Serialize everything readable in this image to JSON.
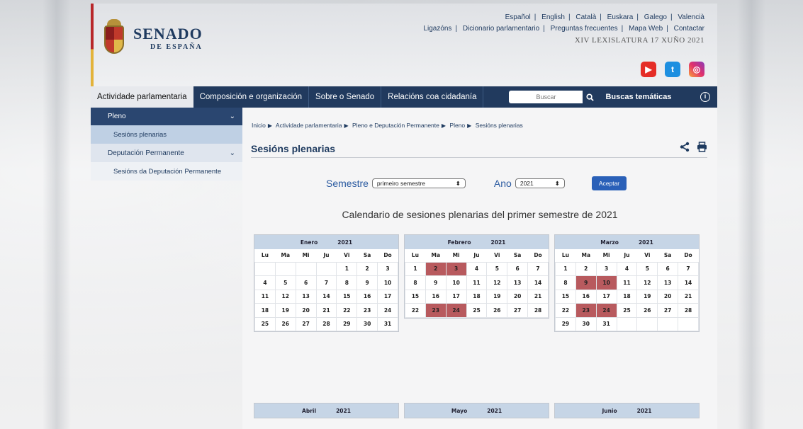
{
  "header": {
    "logo_title": "SENADO",
    "logo_subtitle": "DE ESPAÑA",
    "languages": [
      "Español",
      "English",
      "Català",
      "Euskara",
      "Galego",
      "Valencià"
    ],
    "links": [
      "Ligazóns",
      "Dicionario parlamentario",
      "Preguntas frecuentes",
      "Mapa Web",
      "Contactar"
    ],
    "legislature": "XIV LEXISLATURA 17 XUÑO 2021",
    "social_icons": [
      "youtube-icon",
      "twitter-icon",
      "instagram-icon"
    ]
  },
  "nav": {
    "items": [
      "Actividade parlamentaria",
      "Composición e organización",
      "Sobre o Senado",
      "Relacións coa cidadanía"
    ],
    "search_placeholder": "Buscar",
    "tematicas": "Buscas temáticas",
    "info_glyph": "i"
  },
  "sidebar": {
    "pleno": "Pleno",
    "sesions_plenarias": "Sesións plenarias",
    "deputacion": "Deputación Permanente",
    "sesions_deputacion": "Sesións da Deputación Permanente"
  },
  "main": {
    "breadcrumb": [
      "Inicio",
      "Actividade parlamentaria",
      "Pleno e Deputación Permanente",
      "Pleno",
      "Sesións plenarias"
    ],
    "title": "Sesións plenarias",
    "semestre_label": "Semestre",
    "semestre_value": "primeiro semestre",
    "ano_label": "Ano",
    "ano_value": "2021",
    "accept": "Aceptar",
    "calendar_heading": "Calendario de sesiones plenarias del primer semestre de 2021"
  },
  "weekdays": [
    "Lu",
    "Ma",
    "Mi",
    "Ju",
    "Vi",
    "Sa",
    "Do"
  ],
  "colors": {
    "nav": "#213a5e",
    "highlight": "#b85a5e",
    "cal_header": "#c6d5e6"
  },
  "calendars": [
    {
      "month": "Enero",
      "year": "2021",
      "offset": 4,
      "days": 31,
      "highlight": []
    },
    {
      "month": "Febrero",
      "year": "2021",
      "offset": 0,
      "days": 28,
      "highlight": [
        2,
        3,
        23,
        24
      ]
    },
    {
      "month": "Marzo",
      "year": "2021",
      "offset": 0,
      "days": 31,
      "highlight": [
        9,
        10,
        23,
        24
      ]
    },
    {
      "month": "Abril",
      "year": "2021"
    },
    {
      "month": "Mayo",
      "year": "2021"
    },
    {
      "month": "Junio",
      "year": "2021"
    }
  ]
}
